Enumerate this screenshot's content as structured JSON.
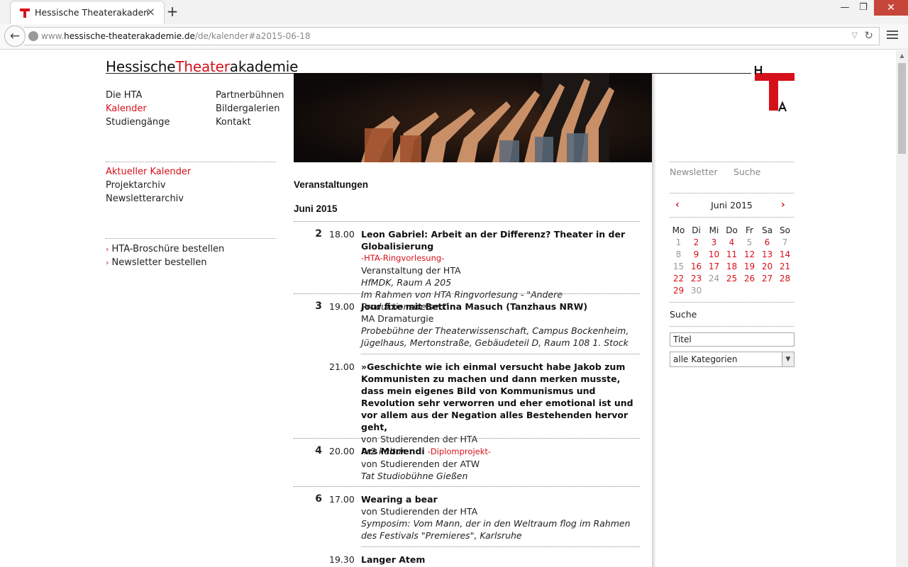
{
  "browser": {
    "tab_title": "Hessische Theaterakademi...",
    "tab_close": "×",
    "new_tab": "+",
    "url_prefix": "www.",
    "url_domain": "hessische-theaterakademie.de",
    "url_path": "/de/kalender#a2015-06-18",
    "win_min": "—",
    "win_max": "❐",
    "win_close": "✕"
  },
  "site": {
    "logo_part1": "Hessische",
    "logo_part2": "Theater",
    "logo_part3": "akademie",
    "brand_red": "#d6101a"
  },
  "nav": {
    "left": [
      "Die HTA",
      "Kalender",
      "Studiengänge"
    ],
    "right": [
      "Partnerbühnen",
      "Bildergalerien",
      "Kontakt"
    ],
    "sub": [
      "Aktueller Kalender",
      "Projektarchiv",
      "Newsletterarchiv"
    ],
    "extra": [
      "HTA-Broschüre bestellen",
      "Newsletter bestellen"
    ],
    "extra_arrow": "›"
  },
  "main": {
    "heading": "Veranstaltungen",
    "month": "Juni 2015",
    "events": [
      {
        "day": "2",
        "time": "18.00",
        "title": "Leon Gabriel: Arbeit an der Differenz? Theater in der Globalisierung",
        "category": "-HTA-Ringvorlesung-",
        "line1": "Veranstaltung der HTA",
        "line2": "HfMDK, Raum A 205",
        "line3": "Im Rahmen von HTA Ringvorlesung - \"Andere Produktionsweisen\""
      },
      {
        "day": "3",
        "time": "19.00",
        "title": "Jour fixe mit Bettina Masuch (Tanzhaus NRW)",
        "line1": "MA Dramaturgie",
        "line2": "Probebühne der Theaterwissenschaft, Campus Bockenheim, Jügelhaus, Mertonstraße, Gebäudeteil D, Raum 108 1. Stock"
      },
      {
        "day": "",
        "time": "21.00",
        "title": "»Geschichte wie ich einmal versucht habe Jakob zum Kommunisten zu machen und dann merken musste, dass mein eigenes Bild von Kommunismus und Revolution sehr verworren und eher emotional ist und vor allem aus der Negation alles Bestehenden hervor geht,",
        "line1": "von Studierenden der HTA",
        "line2": "hr2 kultur"
      },
      {
        "day": "4",
        "time": "20.00",
        "title": "Ars Moriendi",
        "category": "-Diplomprojekt-",
        "line1": "von Studierenden der ATW",
        "line2": "Tat Studiobühne Gießen"
      },
      {
        "day": "6",
        "time": "17.00",
        "title": "Wearing a bear",
        "line1": "von Studierenden der HTA",
        "line2": "Symposim: Vom Mann, der in den Weltraum flog im Rahmen des Festivals \"Premieres\", Karlsruhe"
      },
      {
        "day": "",
        "time": "19.30",
        "title": "Langer Atem"
      }
    ]
  },
  "sidebar": {
    "tab_newsletter": "Newsletter",
    "tab_search": "Suche",
    "cal_prev": "‹",
    "cal_next": "›",
    "cal_month": "Juni 2015",
    "weekdays": [
      "Mo",
      "Di",
      "Mi",
      "Do",
      "Fr",
      "Sa",
      "So"
    ],
    "weeks": [
      [
        {
          "d": "1",
          "s": "g"
        },
        {
          "d": "2",
          "s": "r"
        },
        {
          "d": "3",
          "s": "r"
        },
        {
          "d": "4",
          "s": "r"
        },
        {
          "d": "5",
          "s": "g"
        },
        {
          "d": "6",
          "s": "r"
        },
        {
          "d": "7",
          "s": "g"
        }
      ],
      [
        {
          "d": "8",
          "s": "g"
        },
        {
          "d": "9",
          "s": "r"
        },
        {
          "d": "10",
          "s": "r"
        },
        {
          "d": "11",
          "s": "r"
        },
        {
          "d": "12",
          "s": "r"
        },
        {
          "d": "13",
          "s": "r"
        },
        {
          "d": "14",
          "s": "r"
        }
      ],
      [
        {
          "d": "15",
          "s": "g"
        },
        {
          "d": "16",
          "s": "r"
        },
        {
          "d": "17",
          "s": "r"
        },
        {
          "d": "18",
          "s": "r"
        },
        {
          "d": "19",
          "s": "r"
        },
        {
          "d": "20",
          "s": "r"
        },
        {
          "d": "21",
          "s": "r"
        }
      ],
      [
        {
          "d": "22",
          "s": "r"
        },
        {
          "d": "23",
          "s": "r"
        },
        {
          "d": "24",
          "s": "g"
        },
        {
          "d": "25",
          "s": "r"
        },
        {
          "d": "26",
          "s": "r"
        },
        {
          "d": "27",
          "s": "r"
        },
        {
          "d": "28",
          "s": "r"
        }
      ],
      [
        {
          "d": "29",
          "s": "r"
        },
        {
          "d": "30",
          "s": "g"
        }
      ]
    ],
    "search_label": "Suche",
    "search_value": "Titel",
    "category_select": "alle Kategorien"
  }
}
